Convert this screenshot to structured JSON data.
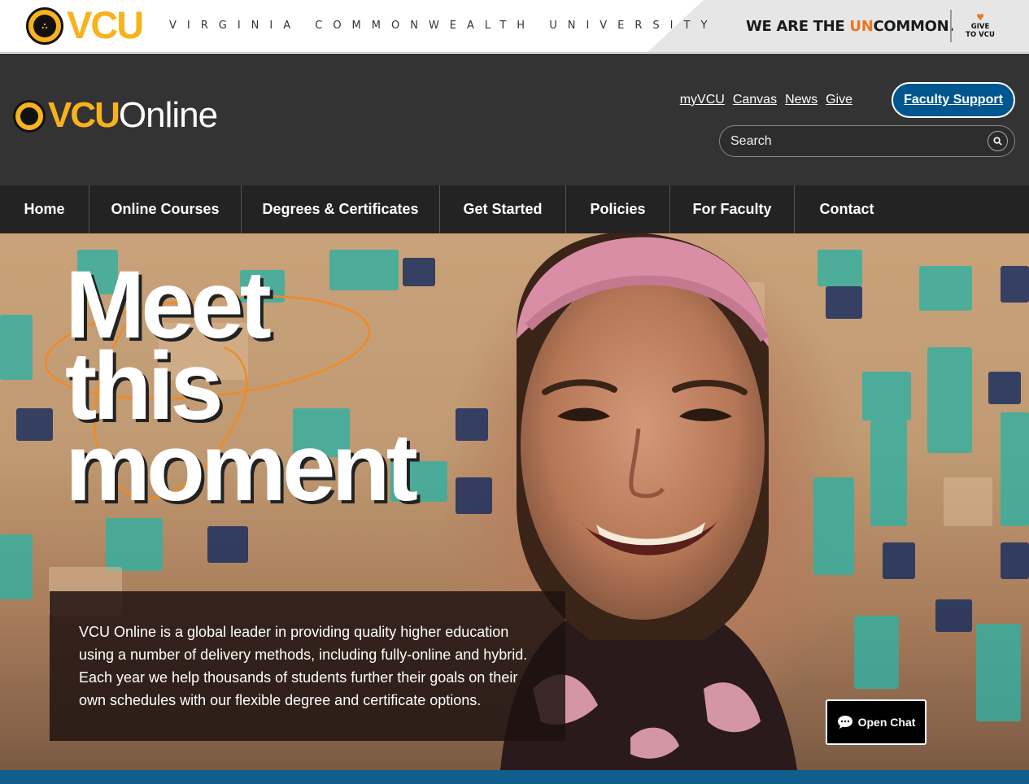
{
  "university_bar": {
    "logo_mark": "VCU seal",
    "wordmark": "VCU",
    "fullname": "VIRGINIA COMMONWEALTH UNIVERSITY",
    "tagline_pre": "WE ARE THE ",
    "tagline_hl": "UN",
    "tagline_post": "COMMON.",
    "give_line1": "GIVE",
    "give_line2": "TO VCU",
    "accent": "#f8b21c",
    "highlight": "#e87722"
  },
  "site_header": {
    "wordmark_vcu": "VCU",
    "wordmark_online": "Online",
    "utility_links": [
      {
        "label": "myVCU"
      },
      {
        "label": "Canvas"
      },
      {
        "label": "News"
      },
      {
        "label": "Give"
      }
    ],
    "faculty_support": "Faculty Support",
    "search_placeholder": "Search",
    "search_icon": "search-icon",
    "bg_color": "#333333",
    "button_color": "#00578f"
  },
  "nav": {
    "items": [
      {
        "label": "Home"
      },
      {
        "label": "Online Courses"
      },
      {
        "label": "Degrees & Certificates"
      },
      {
        "label": "Get Started"
      },
      {
        "label": "Policies"
      },
      {
        "label": "For Faculty"
      },
      {
        "label": "Contact"
      }
    ]
  },
  "hero": {
    "title_line1": "Meet",
    "title_line2": "this",
    "title_line3": "moment",
    "caption": "VCU Online is a global leader in providing quality higher education using a number of delivery methods, including fully-online and hybrid. Each year we help thousands of students further their goals on their own schedules with our flexible degree and certificate options.",
    "chat_label": "Open Chat",
    "chat_icon": "chat-bubble-icon"
  }
}
